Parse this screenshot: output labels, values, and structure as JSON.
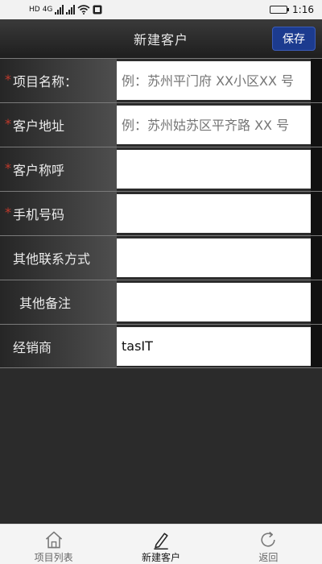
{
  "status_bar": {
    "network_1": "HD",
    "network_2": "4G",
    "time": "1:16"
  },
  "header": {
    "title": "新建客户",
    "save_label": "保存"
  },
  "form": {
    "fields": [
      {
        "label": "项目名称：",
        "required": true,
        "placeholder": "例：苏州平门府 XX小区XX 号",
        "value": ""
      },
      {
        "label": "客户地址",
        "required": true,
        "placeholder": "例：苏州姑苏区平齐路 XX 号",
        "value": ""
      },
      {
        "label": "客户称呼",
        "required": true,
        "placeholder": "",
        "value": ""
      },
      {
        "label": "手机号码",
        "required": true,
        "placeholder": "",
        "value": ""
      },
      {
        "label": "其他联系方式",
        "required": false,
        "placeholder": "",
        "value": ""
      },
      {
        "label": "其他备注",
        "required": false,
        "placeholder": "",
        "value": ""
      },
      {
        "label": "经销商",
        "required": false,
        "placeholder": "",
        "value": "tasIT"
      }
    ],
    "required_mark": "*"
  },
  "tabbar": {
    "tabs": [
      {
        "label": "项目列表",
        "icon": "home-icon"
      },
      {
        "label": "新建客户",
        "icon": "pencil-icon"
      },
      {
        "label": "返回",
        "icon": "refresh-icon"
      }
    ]
  },
  "colors": {
    "accent": "#1c3b8f",
    "required": "#c0392b"
  }
}
